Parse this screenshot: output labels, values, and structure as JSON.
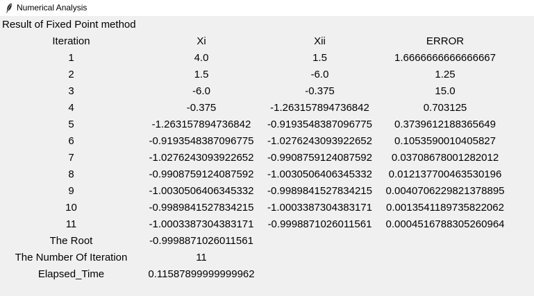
{
  "window": {
    "title": "Numerical Analysis"
  },
  "heading": "Result of Fixed Point method",
  "table": {
    "headers": [
      "Iteration",
      "Xi",
      "Xii",
      "ERROR"
    ],
    "rows": [
      [
        "1",
        "4.0",
        "1.5",
        "1.6666666666666667"
      ],
      [
        "2",
        "1.5",
        "-6.0",
        "1.25"
      ],
      [
        "3",
        "-6.0",
        "-0.375",
        "15.0"
      ],
      [
        "4",
        "-0.375",
        "-1.263157894736842",
        "0.703125"
      ],
      [
        "5",
        "-1.263157894736842",
        "-0.9193548387096775",
        "0.3739612188365649"
      ],
      [
        "6",
        "-0.9193548387096775",
        "-1.0276243093922652",
        "0.1053590010405827"
      ],
      [
        "7",
        "-1.0276243093922652",
        "-0.9908759124087592",
        "0.03708678001282012"
      ],
      [
        "8",
        "-0.9908759124087592",
        "-1.0030506406345332",
        "0.012137700463530196"
      ],
      [
        "9",
        "-1.0030506406345332",
        "-0.9989841527834215",
        "0.004070622982137889 5"
      ],
      [
        "10",
        "-0.9989841527834215",
        "-1.0003387304383171",
        "0.0013541189735822062"
      ],
      [
        "11",
        "-1.0003387304383171",
        "-0.9998871026011561",
        "0.0004516788305260964"
      ]
    ]
  },
  "summary": [
    {
      "label": "The Root",
      "value": "-0.9998871026011561"
    },
    {
      "label": "The Number Of Iteration",
      "value": "11"
    },
    {
      "label": "Elapsed_Time",
      "value": "0.11587899999999962"
    }
  ]
}
